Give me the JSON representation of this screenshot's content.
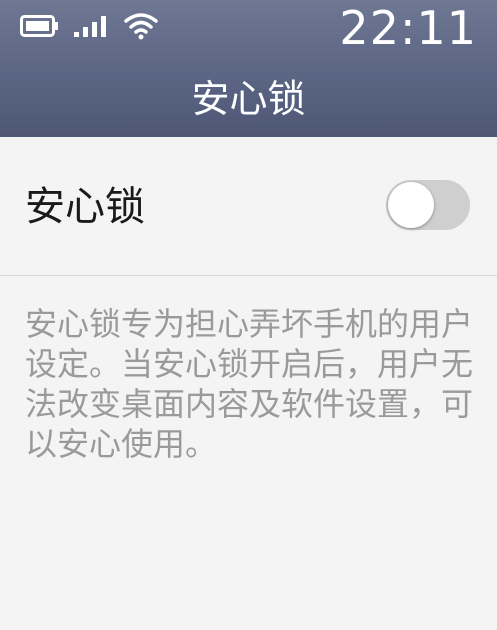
{
  "status_bar": {
    "time": "22:11",
    "icons": [
      "battery-icon",
      "signal-icon",
      "wifi-icon"
    ]
  },
  "header": {
    "title": "安心锁"
  },
  "setting": {
    "label": "安心锁",
    "toggle_on": false
  },
  "description": {
    "text": "安心锁专为担心弄坏手机的用户设定。当安心锁开启后，用户无法改变桌面内容及软件设置，可以安心使用。"
  },
  "colors": {
    "header_bg": "#5b6584",
    "page_bg": "#f4f4f4",
    "toggle_off": "#cfcfcf",
    "desc_text": "#9a9a9a"
  }
}
